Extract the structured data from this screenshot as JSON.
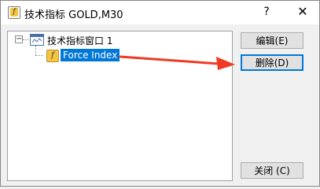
{
  "window": {
    "title": "技术指标 GOLD,M30",
    "help_label": "?",
    "close_label": "✕"
  },
  "tree": {
    "nodes": [
      {
        "label": "技术指标窗口 1",
        "icon": "chart-window-icon",
        "expander": "−"
      },
      {
        "label": "Force Index",
        "icon": "function-icon",
        "selected": true
      }
    ]
  },
  "buttons": {
    "edit": "编辑(E)",
    "delete": "删除(D)",
    "close": "关闭 (C)"
  },
  "annotation": {
    "arrow_color": "#ee3b24"
  },
  "colors": {
    "selection": "#0078d7",
    "focus_border": "#0078d7"
  }
}
